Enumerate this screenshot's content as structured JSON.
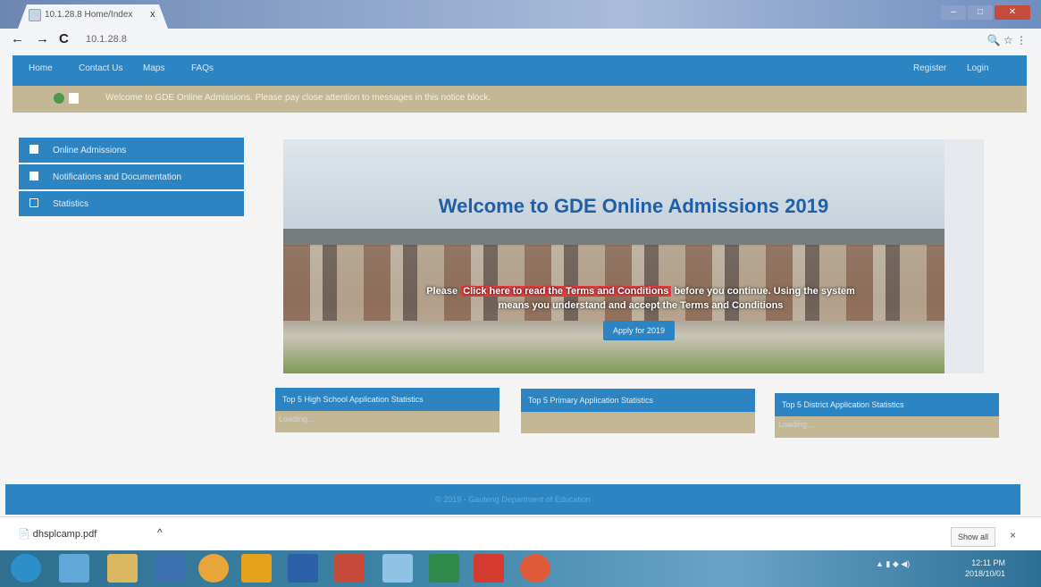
{
  "browser": {
    "tab_title": "10.1.28.8 Home/Index",
    "tab_close": "x",
    "address": "10.1.28.8",
    "nav_back": "←",
    "nav_forward": "→",
    "nav_reload": "C",
    "addr_icons": "🔍 ☆ ⋮"
  },
  "navbar": {
    "items": [
      "Home",
      "Contact Us",
      "Maps",
      "FAQs"
    ],
    "right_items": [
      "Register",
      "Login"
    ]
  },
  "notice": {
    "text": "Welcome to GDE Online Admissions. Please pay close attention to messages in this notice block."
  },
  "sidebar": {
    "items": [
      {
        "label": "Online Admissions"
      },
      {
        "label": "Notifications and Documentation"
      },
      {
        "label": "Statistics"
      }
    ]
  },
  "hero": {
    "title": "Welcome to GDE Online Admissions 2019",
    "terms_prefix": "Please",
    "terms_link": "Click here to read the Terms and Conditions",
    "terms_suffix": "before you continue. Using the system means you understand and accept the Terms and Conditions",
    "apply_button": "Apply for 2019"
  },
  "stats": [
    {
      "title": "Top 5 High School Application Statistics",
      "footer": "Loading..."
    },
    {
      "title": "Top 5 Primary Application Statistics",
      "footer": ""
    },
    {
      "title": "Top 5 District Application Statistics",
      "footer": "Loading..."
    }
  ],
  "footer": {
    "text": "© 2019 - Gauteng Department of Education"
  },
  "download": {
    "filename": "dhsplcamp.pdf",
    "chevron": "^",
    "show_all": "Show all",
    "close": "×"
  },
  "taskbar": {
    "tray": "▲ ▮ ◆ ◀)",
    "time": "12:11 PM",
    "date": "2018/10/01"
  }
}
